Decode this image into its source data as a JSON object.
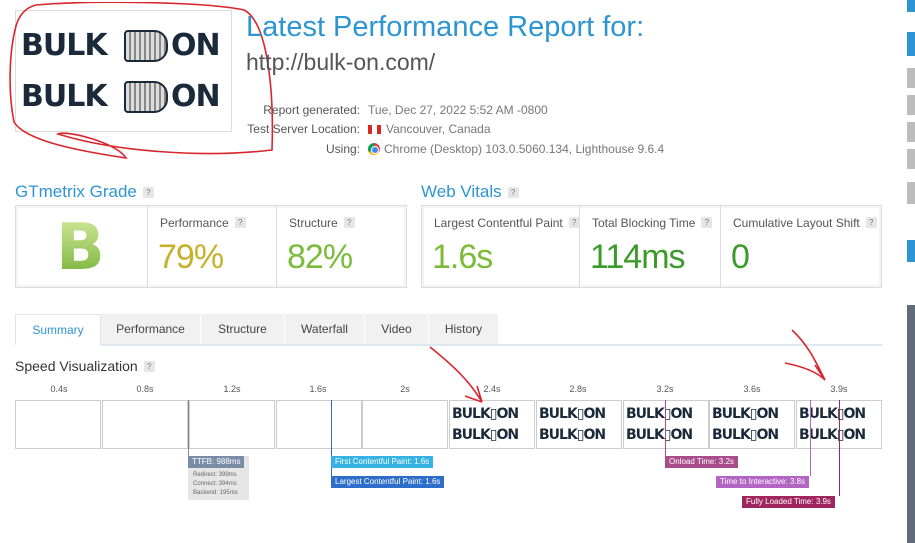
{
  "report": {
    "title": "Latest Performance Report for:",
    "url": "http://bulk-on.com/",
    "thumbnail_logo": "BULK ON",
    "meta": [
      {
        "label": "Report generated:",
        "value": "Tue, Dec 27, 2022 5:52 AM -0800",
        "icon": ""
      },
      {
        "label": "Test Server Location:",
        "value": "Vancouver, Canada",
        "icon": "canada-flag-icon"
      },
      {
        "label": "Using:",
        "value": "Chrome (Desktop) 103.0.5060.134, Lighthouse 9.6.4",
        "icon": "chrome-icon"
      }
    ]
  },
  "grade": {
    "heading": "GTmetrix Grade",
    "letter": "B",
    "performance_label": "Performance",
    "performance_value": "79%",
    "structure_label": "Structure",
    "structure_value": "82%"
  },
  "vitals": {
    "heading": "Web Vitals",
    "items": [
      {
        "label": "Largest Contentful Paint",
        "value": "1.6s"
      },
      {
        "label": "Total Blocking Time",
        "value": "114ms"
      },
      {
        "label": "Cumulative Layout Shift",
        "value": "0"
      }
    ]
  },
  "tabs": [
    "Summary",
    "Performance",
    "Structure",
    "Waterfall",
    "Video",
    "History"
  ],
  "active_tab": "Summary",
  "speed": {
    "heading": "Speed Visualization",
    "ticks": [
      "0.4s",
      "0.8s",
      "1.2s",
      "1.6s",
      "2s",
      "2.4s",
      "2.8s",
      "3.2s",
      "3.6s",
      "3.9s"
    ],
    "frame_logo": "BULK ON",
    "markers": {
      "ttfb": "TTFB: 988ms",
      "redirect": "Redirect: 399ms",
      "connect": "Connect: 394ms",
      "backend": "Backend: 195ms",
      "fcp": "First Contentful Paint: 1.6s",
      "lcp": "Largest Contentful Paint: 1.6s",
      "onload": "Onload Time: 3.2s",
      "tti": "Time to Interactive: 3.8s",
      "fully_loaded": "Fully Loaded Time: 3.9s"
    }
  },
  "colors": {
    "accent": "#2e95d3",
    "grade_b": "#8fc548",
    "performance": "#c6b12a",
    "structure": "#7cbb39",
    "vitals_good": "#3b9b2a",
    "ttfb": "#7a8ca6",
    "fcp": "#36b3e4",
    "lcp": "#2c6ec9",
    "onload": "#a84c8a",
    "tti": "#b365c4",
    "fully_loaded": "#a0265f",
    "annotation": "#d9262c"
  }
}
